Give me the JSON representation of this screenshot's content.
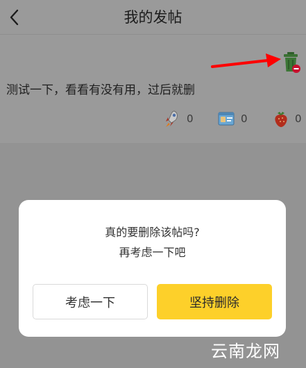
{
  "header": {
    "title": "我的发帖"
  },
  "post": {
    "content": "测试一下，看看有没有用，过后就删",
    "stats": [
      {
        "icon": "rocket-icon",
        "count": "0"
      },
      {
        "icon": "id-card-icon",
        "count": "0"
      },
      {
        "icon": "strawberry-icon",
        "count": "0"
      }
    ]
  },
  "dialog": {
    "message_line1": "真的要删除该帖吗?",
    "message_line2": "再考虑一下吧",
    "cancel_label": "考虑一下",
    "confirm_label": "坚持删除"
  },
  "watermark": "云南龙网",
  "colors": {
    "confirm": "#fdd02a",
    "annotation_arrow": "#ff0000",
    "overlay": "#9a9a9a"
  }
}
